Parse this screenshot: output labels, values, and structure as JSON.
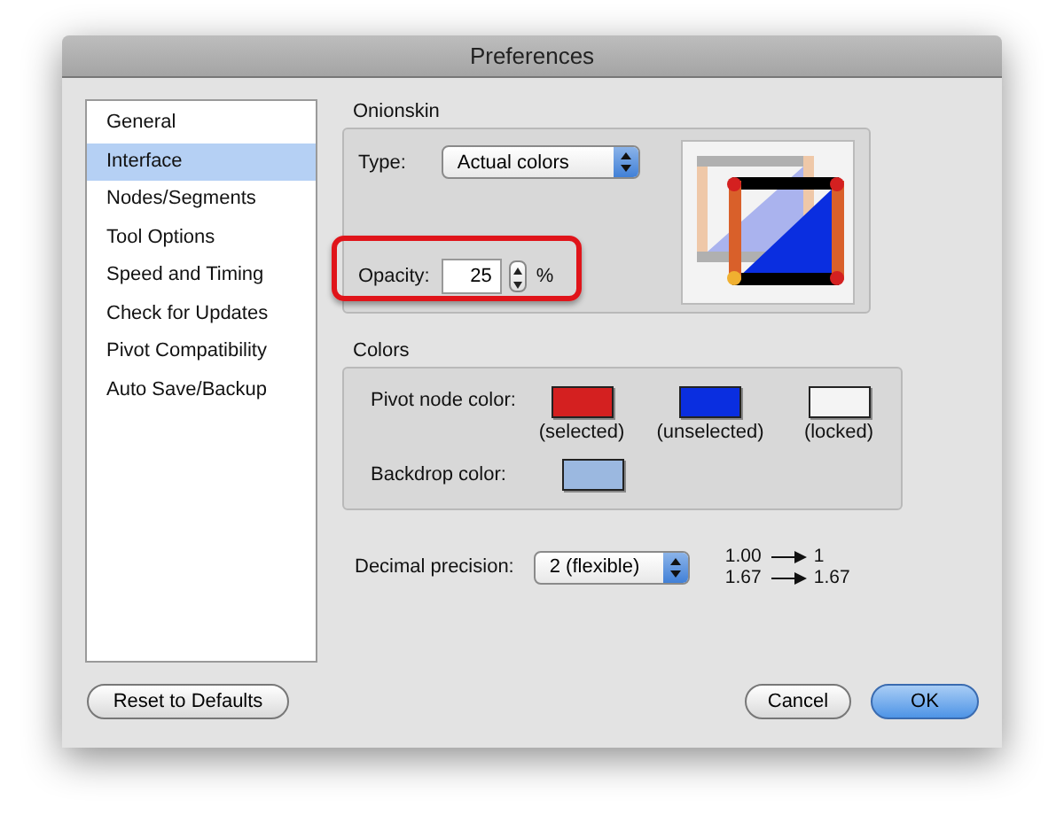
{
  "window": {
    "title": "Preferences"
  },
  "sidebar": {
    "items": [
      {
        "label": "General",
        "selected": false
      },
      {
        "label": "Interface",
        "selected": true
      },
      {
        "label": "Nodes/Segments",
        "selected": false
      },
      {
        "label": "Tool Options",
        "selected": false
      },
      {
        "label": "Speed and Timing",
        "selected": false
      },
      {
        "label": "Check for Updates",
        "selected": false
      },
      {
        "label": "Pivot Compatibility",
        "selected": false
      },
      {
        "label": "Auto Save/Backup",
        "selected": false
      }
    ]
  },
  "onionskin": {
    "title": "Onionskin",
    "type_label": "Type:",
    "type_value": "Actual colors",
    "opacity_label": "Opacity:",
    "opacity_value": "25",
    "opacity_unit": "%",
    "opacity_highlighted": true
  },
  "colors": {
    "title": "Colors",
    "pivot_label": "Pivot node color:",
    "pivot_swatches": [
      {
        "caption": "(selected)",
        "color": "#d42020"
      },
      {
        "caption": "(unselected)",
        "color": "#0a2ee0"
      },
      {
        "caption": "(locked)",
        "color": "#f4f4f4"
      }
    ],
    "backdrop_label": "Backdrop color:",
    "backdrop_swatches": [
      {
        "color": "#9bb8e0"
      }
    ]
  },
  "decimal": {
    "label": "Decimal precision:",
    "value": "2 (flexible)",
    "examples": [
      {
        "from": "1.00",
        "to": "1"
      },
      {
        "from": "1.67",
        "to": "1.67"
      }
    ]
  },
  "buttons": {
    "reset": "Reset to Defaults",
    "cancel": "Cancel",
    "ok": "OK"
  }
}
